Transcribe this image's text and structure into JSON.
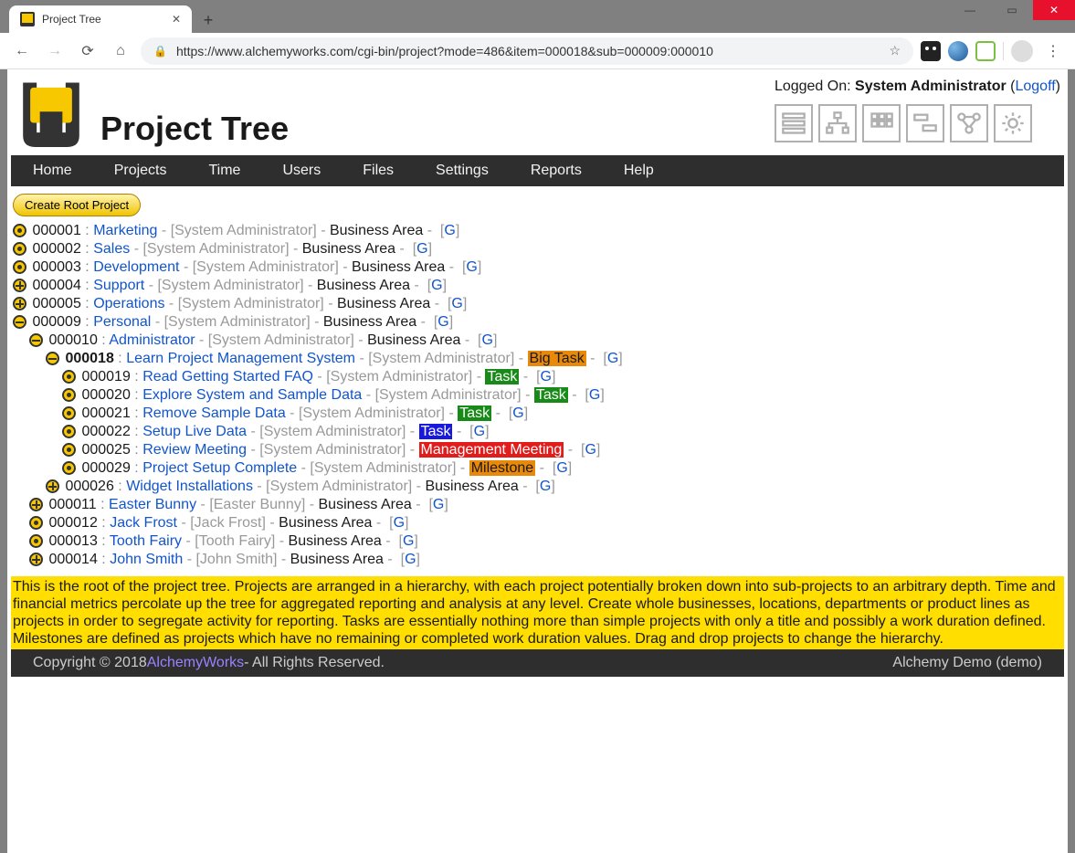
{
  "window": {
    "tab_title": "Project Tree",
    "url": "https://www.alchemyworks.com/cgi-bin/project?mode=486&item=000018&sub=000009:000010"
  },
  "header": {
    "title": "Project Tree",
    "logged_on_label": "Logged On: ",
    "user": "System Administrator",
    "logoff": "Logoff"
  },
  "nav": [
    "Home",
    "Projects",
    "Time",
    "Users",
    "Files",
    "Settings",
    "Reports",
    "Help"
  ],
  "create_button": "Create Root Project",
  "tree": [
    {
      "lvl": 0,
      "icon": "dot",
      "id": "000001",
      "name": "Marketing",
      "owner": "System Administrator",
      "type": "Business Area",
      "g": "G"
    },
    {
      "lvl": 0,
      "icon": "dot",
      "id": "000002",
      "name": "Sales",
      "owner": "System Administrator",
      "type": "Business Area",
      "g": "G"
    },
    {
      "lvl": 0,
      "icon": "dot",
      "id": "000003",
      "name": "Development",
      "owner": "System Administrator",
      "type": "Business Area",
      "g": "G"
    },
    {
      "lvl": 0,
      "icon": "plus",
      "id": "000004",
      "name": "Support",
      "owner": "System Administrator",
      "type": "Business Area",
      "g": "G"
    },
    {
      "lvl": 0,
      "icon": "plus",
      "id": "000005",
      "name": "Operations",
      "owner": "System Administrator",
      "type": "Business Area",
      "g": "G"
    },
    {
      "lvl": 0,
      "icon": "minus",
      "id": "000009",
      "name": "Personal",
      "owner": "System Administrator",
      "type": "Business Area",
      "g": "G"
    },
    {
      "lvl": 1,
      "icon": "minus",
      "id": "000010",
      "name": "Administrator",
      "owner": "System Administrator",
      "type": "Business Area",
      "g": "G"
    },
    {
      "lvl": 2,
      "icon": "minus",
      "id": "000018",
      "bold": true,
      "name": "Learn Project Management System",
      "owner": "System Administrator",
      "tag": "Big Task",
      "tagcls": "orange",
      "g": "G"
    },
    {
      "lvl": 3,
      "icon": "dot",
      "id": "000019",
      "name": "Read Getting Started FAQ",
      "owner": "System Administrator",
      "tag": "Task",
      "tagcls": "green",
      "g": "G"
    },
    {
      "lvl": 3,
      "icon": "dot",
      "id": "000020",
      "name": "Explore System and Sample Data",
      "owner": "System Administrator",
      "tag": "Task",
      "tagcls": "green",
      "g": "G"
    },
    {
      "lvl": 3,
      "icon": "dot",
      "id": "000021",
      "name": "Remove Sample Data",
      "owner": "System Administrator",
      "tag": "Task",
      "tagcls": "green",
      "g": "G"
    },
    {
      "lvl": 3,
      "icon": "dot",
      "id": "000022",
      "name": "Setup Live Data",
      "owner": "System Administrator",
      "tag": "Task",
      "tagcls": "blue",
      "g": "G"
    },
    {
      "lvl": 3,
      "icon": "dot",
      "id": "000025",
      "name": "Review Meeting",
      "owner": "System Administrator",
      "tag": "Management Meeting",
      "tagcls": "red",
      "g": "G"
    },
    {
      "lvl": 3,
      "icon": "dot",
      "id": "000029",
      "name": "Project Setup Complete",
      "owner": "System Administrator",
      "tag": "Milestone",
      "tagcls": "milestone",
      "g": "G"
    },
    {
      "lvl": 2,
      "icon": "plus",
      "id": "000026",
      "name": "Widget Installations",
      "owner": "System Administrator",
      "type": "Business Area",
      "g": "G"
    },
    {
      "lvl": 1,
      "icon": "plus",
      "id": "000011",
      "name": "Easter Bunny",
      "owner": "Easter Bunny",
      "type": "Business Area",
      "g": "G"
    },
    {
      "lvl": 1,
      "icon": "dot",
      "id": "000012",
      "name": "Jack Frost",
      "owner": "Jack Frost",
      "type": "Business Area",
      "g": "G"
    },
    {
      "lvl": 1,
      "icon": "dot",
      "id": "000013",
      "name": "Tooth Fairy",
      "owner": "Tooth Fairy",
      "type": "Business Area",
      "g": "G"
    },
    {
      "lvl": 1,
      "icon": "plus",
      "id": "000014",
      "name": "John Smith",
      "owner": "John Smith",
      "type": "Business Area",
      "g": "G"
    }
  ],
  "info": "This is the root of the project tree. Projects are arranged in a hierarchy, with each project potentially broken down into sub-projects to an arbitrary depth. Time and financial metrics percolate up the tree for aggregated reporting and analysis at any level. Create whole businesses, locations, departments or product lines as projects in order to segregate activity for reporting. Tasks are essentially nothing more than simple projects with only a title and possibly a work duration defined. Milestones are defined as projects which have no remaining or completed work duration values. Drag and drop projects to change the hierarchy.",
  "footer": {
    "copyright": "Copyright © 2018 ",
    "brand": "AlchemyWorks",
    "reserved": " - All Rights Reserved.",
    "right": "Alchemy Demo (demo)"
  }
}
